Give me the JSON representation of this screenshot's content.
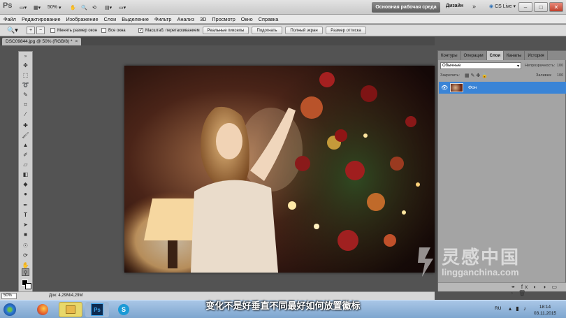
{
  "app": {
    "logo": "Ps",
    "zoom": "50%"
  },
  "appbar": {
    "workspace_button": "Основная рабочая среда",
    "design_button": "Дизайн",
    "more": "»",
    "cslive": "CS Live",
    "minimize": "–",
    "maximize": "□",
    "close": "✕"
  },
  "menu": [
    "Файл",
    "Редактирование",
    "Изображение",
    "Слои",
    "Выделение",
    "Фильтр",
    "Анализ",
    "3D",
    "Просмотр",
    "Окно",
    "Справка"
  ],
  "options": {
    "resize_windows": "Менять размер окон",
    "all_windows": "Все окна",
    "scrubby_zoom": "Масштаб. перетаскиванием",
    "actual_pixels": "Реальные пикселы",
    "fit_screen": "Подогнать",
    "fill_screen": "Полный экран",
    "print_size": "Размер оттиска"
  },
  "document": {
    "tab_title": "DSC09844.jpg @ 50% (RGB/8) *",
    "tab_close": "×"
  },
  "status": {
    "zoom": "50%",
    "doc_info": "Док: 4,29M/4,29M"
  },
  "panel": {
    "tabs": [
      "Контуры",
      "Операции",
      "Слои",
      "Каналы",
      "История"
    ],
    "active_tab": "Слои",
    "blend_mode": "Обычные",
    "opacity_label": "Непрозрачность:",
    "opacity_value": "100",
    "lock_label": "Закрепить:",
    "fill_label": "Заливка:",
    "fill_value": "100",
    "layer_name": "Фон"
  },
  "subtitle": "变化不是好垂直不同最好如何放置徽标",
  "watermark": {
    "cn": "灵感中国",
    "url": "lingganchina.com"
  },
  "clock": {
    "time": "18:14",
    "date": "03.11.2015",
    "lang": "RU"
  },
  "taskbar": {
    "ps_label": "Ps"
  },
  "colors": {
    "accent": "#3a84d6",
    "panel_bg": "#a4a4a4",
    "app_bg": "#535353"
  }
}
